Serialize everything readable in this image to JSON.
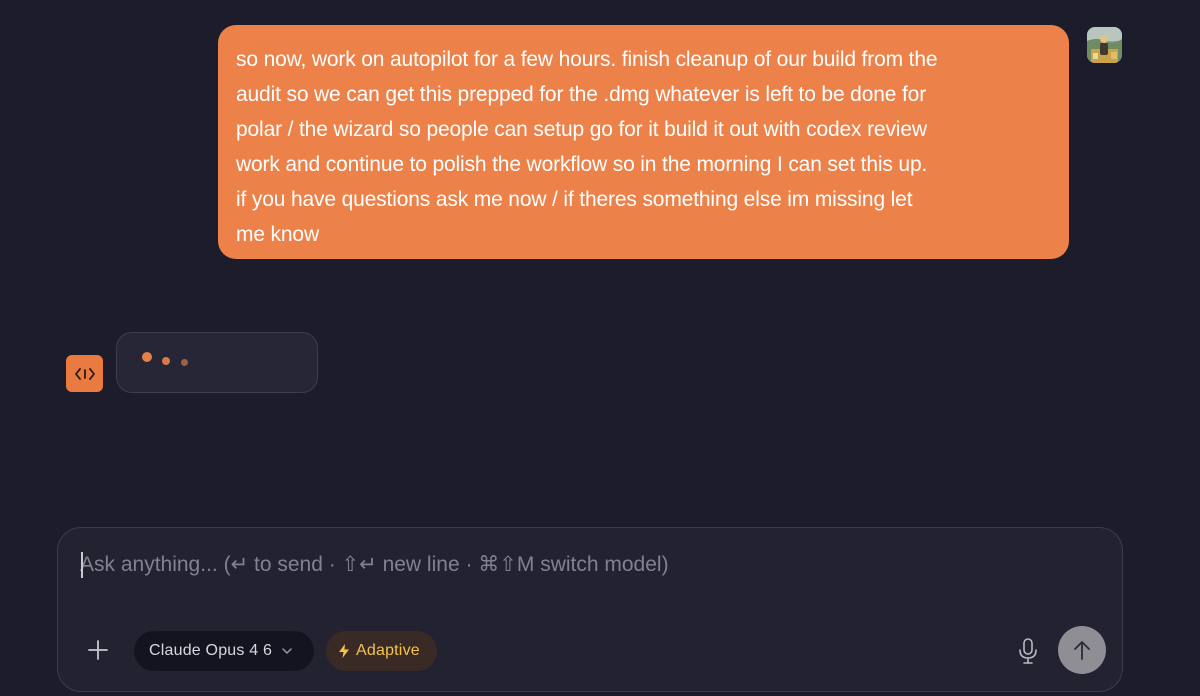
{
  "conversation": {
    "user_message": {
      "text": "so now, work on autopilot for a few hours. finish cleanup of our build from the\naudit so we can get this prepped for the .dmg whatever is left to be done for\npolar / the wizard so people can setup go for it build it out with codex review\nwork and continue to polish the workflow so in the morning I can set this up.\nif you have questions ask me now / if theres something else im missing let\nme know",
      "bubble_color": "#ec814a",
      "avatar_icon": "user-photo-avatar"
    },
    "assistant_status": {
      "state": "typing",
      "avatar_icon": "code-brackets-icon",
      "accent_color": "#e97a40"
    }
  },
  "composer": {
    "placeholder": "Ask anything... (↵ to send · ⇧↵ new line · ⌘⇧M switch model)",
    "value": "",
    "add_icon": "plus-icon",
    "model_label": "Claude Opus 4 6",
    "model_icon": "chevron-down-icon",
    "mode_label": "Adaptive",
    "mode_icon": "lightning-icon",
    "mode_color": "#f3c34a",
    "mic_icon": "microphone-icon",
    "send_icon": "arrow-up-icon"
  },
  "theme": {
    "background": "#1c1c2a",
    "surface": "#222231"
  }
}
